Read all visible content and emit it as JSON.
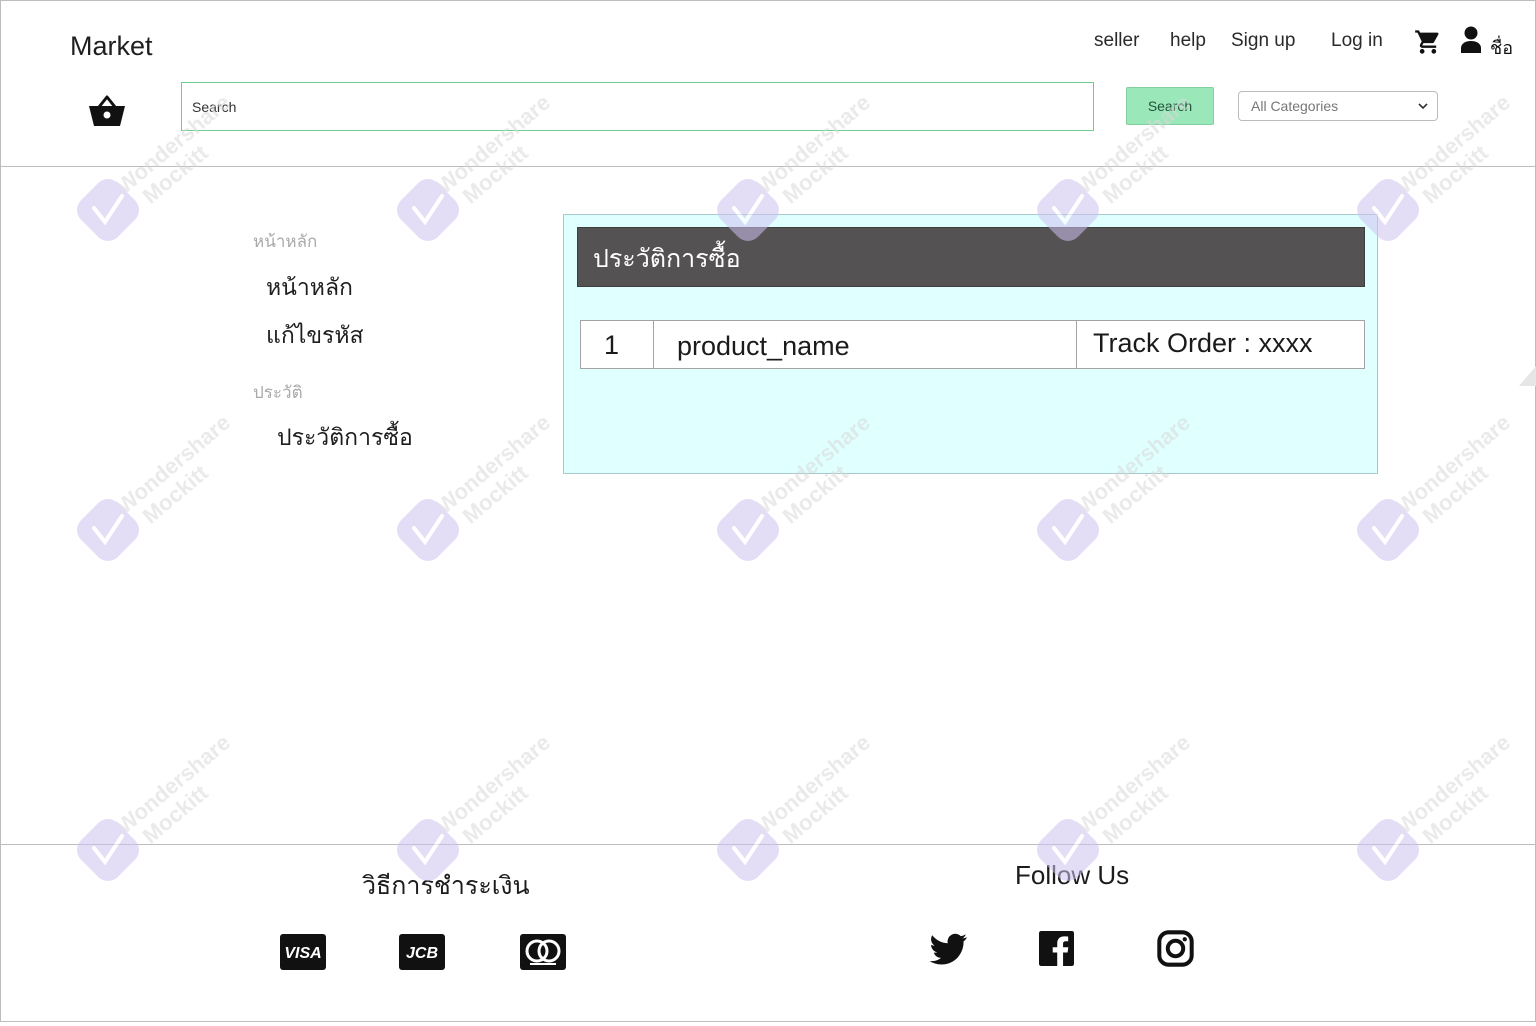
{
  "header": {
    "brand": "Market",
    "nav": [
      "seller",
      "help",
      "Sign up",
      "Log in"
    ],
    "user_name": "ชื่อ",
    "icons": {
      "cart": "cart-icon",
      "user": "user-icon",
      "basket": "basket-icon"
    }
  },
  "search": {
    "placeholder": "Search",
    "button_label": "Search",
    "category_selected": "All Categories"
  },
  "sidebar": {
    "section_main": "หน้าหลัก",
    "items_main": [
      "หน้าหลัก",
      "แก้ไขรหัส"
    ],
    "section_history": "ประวัติ",
    "items_history": [
      "ประวัติการซื้อ"
    ]
  },
  "history_panel": {
    "title": "ประวัติการซื้อ",
    "orders": [
      {
        "index": "1",
        "product": "product_name",
        "track": "Track Order : xxxx"
      }
    ]
  },
  "footer": {
    "payment_title": "วิธีการชำระเงิน",
    "payment_methods": [
      "visa-icon",
      "jcb-icon",
      "mastercard-icon"
    ],
    "follow_title": "Follow Us",
    "social": [
      "twitter-icon",
      "facebook-icon",
      "instagram-icon"
    ]
  },
  "watermark": {
    "line1": "Wondershare",
    "line2": "Mockitt"
  },
  "colors": {
    "accent_green": "#9ae8b9",
    "panel_bg": "#e0ffff",
    "panel_title_bg": "#545252",
    "watermark": "#d9d9d9"
  }
}
